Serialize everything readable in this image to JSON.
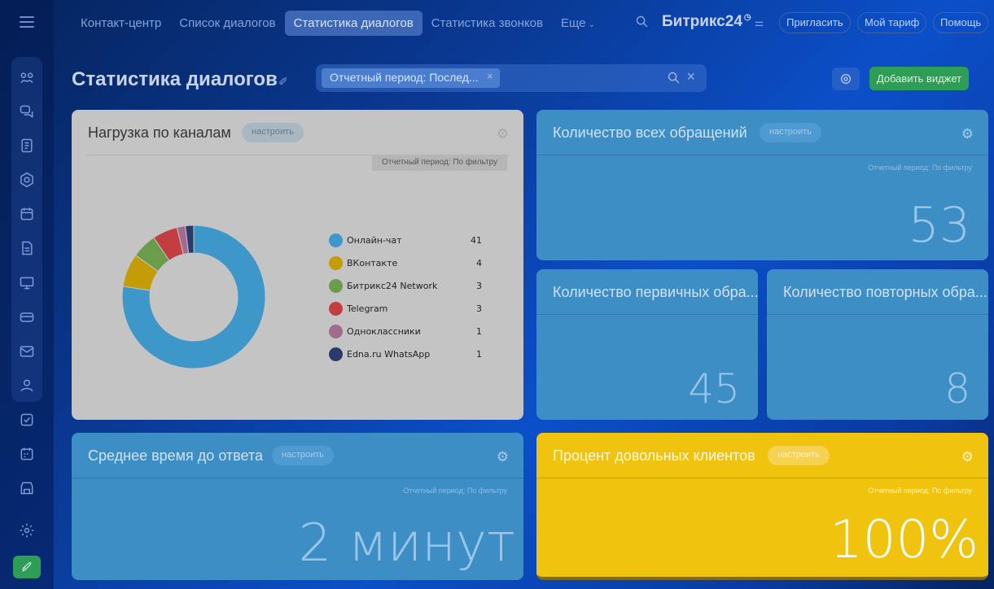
{
  "nav": {
    "tabs": [
      {
        "label": "Контакт-центр"
      },
      {
        "label": "Список диалогов"
      },
      {
        "label": "Статистика диалогов"
      },
      {
        "label": "Статистика звонков"
      },
      {
        "label": "Еще"
      }
    ],
    "logo": "Битрикс",
    "logo_num": "24",
    "invite": "Пригласить",
    "tariff": "Мой тариф",
    "help": "Помощь"
  },
  "page": {
    "title": "Статистика диалогов",
    "filter_chip": "Отчетный период: Послед...",
    "add_widget": "Добавить виджет"
  },
  "widgets": {
    "channels": {
      "title": "Нагрузка по каналам",
      "config": "настроить",
      "period": "Отчетный период: По фильтру"
    },
    "all_requests": {
      "title": "Количество всех обращений",
      "config": "настроить",
      "period": "Отчетный период: По фильтру",
      "value": "53"
    },
    "first_requests": {
      "title": "Количество первичных обра...",
      "value": "45"
    },
    "repeat_requests": {
      "title": "Количество повторных обра...",
      "value": "8"
    },
    "response_time": {
      "title": "Среднее время до ответа",
      "config": "настроить",
      "period": "Отчетный период: По фильтру",
      "value": "2 минут"
    },
    "satisfied": {
      "title": "Процент довольных клиентов",
      "config": "настроить",
      "period": "Отчетный период: По фильтру",
      "value": "100%"
    }
  },
  "chart_data": {
    "type": "pie",
    "donut": true,
    "title": "Нагрузка по каналам",
    "series": [
      {
        "name": "Онлайн-чат",
        "value": 41,
        "color": "#3d97c8"
      },
      {
        "name": "ВКонтакте",
        "value": 4,
        "color": "#c39c06"
      },
      {
        "name": "Битрикс24 Network",
        "value": 3,
        "color": "#6a9c4c"
      },
      {
        "name": "Telegram",
        "value": 3,
        "color": "#c23e40"
      },
      {
        "name": "Одноклассники",
        "value": 1,
        "color": "#a36a8f"
      },
      {
        "name": "Edna.ru WhatsApp",
        "value": 1,
        "color": "#2a3b6b"
      }
    ],
    "legend": "right"
  },
  "colors": {
    "accent_green": "#2e9e57",
    "widget_blue": "#3e8ec6",
    "widget_yellow": "#f0c30e"
  }
}
